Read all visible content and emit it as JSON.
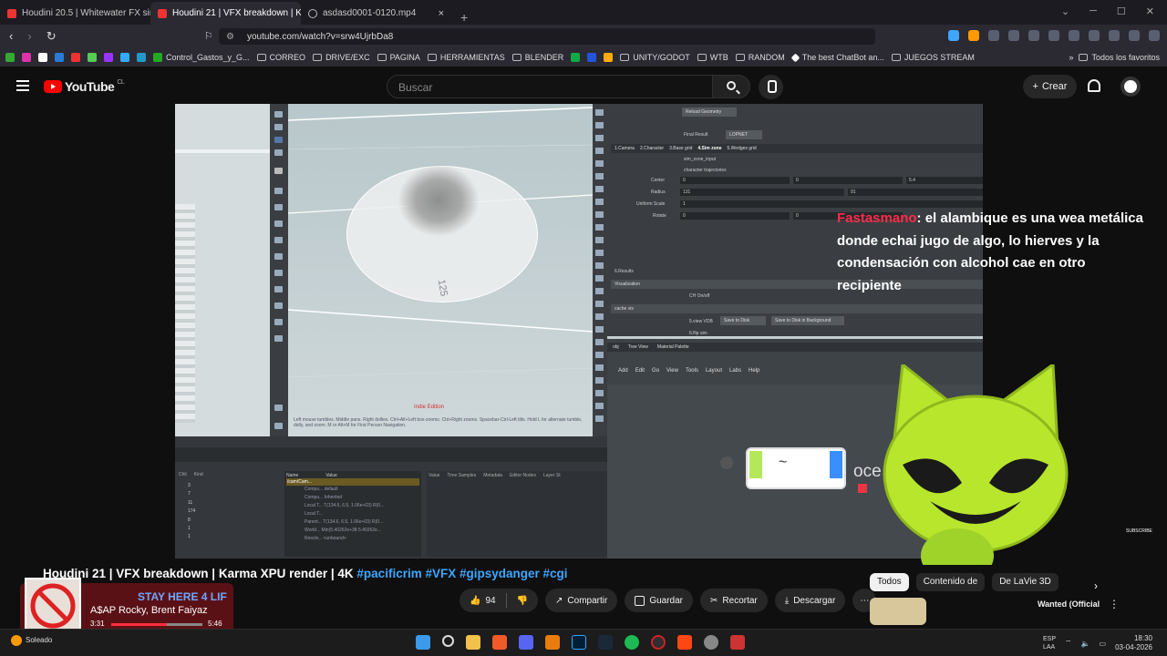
{
  "browser": {
    "tabs": [
      {
        "title": "Houdini 20.5 | Whitewater FX simulat",
        "active": false
      },
      {
        "title": "Houdini 21 | VFX breakdown | K",
        "active": true
      },
      {
        "title": "asdasd0001-0120.mp4",
        "active": false
      }
    ],
    "url": "youtube.com/watch?v=srw4UjrbDa8",
    "bookmarks": [
      "Control_Gastos_y_G...",
      "CORREO",
      "DRIVE/EXC",
      "PAGINA",
      "HERRAMIENTAS",
      "BLENDER",
      "UNITY/GODOT",
      "WTB",
      "RANDOM",
      "The best ChatBot an...",
      "JUEGOS STREAM"
    ],
    "bookmarks_right": "Todos los favoritos"
  },
  "youtube": {
    "logo": "YouTube",
    "region": "CL",
    "search_placeholder": "Buscar",
    "create_label": "Crear"
  },
  "video": {
    "chat_user": "Fastasmano",
    "chat_message": "el alambique es una wea metálica donde echai jugo de algo, lo hierves y la condensación con alcohol cae en otro recipiente",
    "overlay_text": "oce",
    "subscribe_label": "SUBSCRIBE",
    "houdini": {
      "reload_btn": "Reload Geometry",
      "final_result": "Final Result",
      "lopnet": "LOPNET",
      "tabs": [
        "1.Camera",
        "2.Character",
        "3.Base grid",
        "4.Sim zone",
        "5.Wedges grid"
      ],
      "sim_zone_input": "sim_zone_input",
      "character_traj": "character trajectories",
      "center_label": "Center",
      "center_vals": [
        "0",
        "0",
        "5.4"
      ],
      "radius_label": "Radius",
      "radius_vals": [
        "131",
        "91"
      ],
      "uniform_scale_label": "Uniform Scale",
      "uniform_scale": "1",
      "rotate_label": "Rotate",
      "rotate_vals": [
        "0",
        "0"
      ],
      "results_tab": "6.Results",
      "visualization": "Visualization",
      "ch_onoff": "CH On/off",
      "cache_vis": "cache vis",
      "view_vdb": "5.view VDB",
      "flip_sim": "6.flip sim",
      "save_disk": "Save to Disk",
      "save_bg": "Save to Disk in Background",
      "net_tabs": [
        "obj",
        "Tree View",
        "Material Palette"
      ],
      "net_menu": [
        "Add",
        "Edit",
        "Go",
        "View",
        "Tools",
        "Layout",
        "Labs",
        "Help"
      ],
      "indie": "Indie Edition",
      "viewport_help": "Left mouse tumbles. Middle pans. Right dollies. Ctrl+Alt+Left box-zooms. Ctrl+Right zooms. Spacebar-Ctrl-Left tilts. Hold L for alternate tumble, dolly, and zoom. M or Alt+M for First Person Navigation.",
      "viewport_number": "125",
      "tree_col_name": "Name",
      "tree_col_value": "Value",
      "tree_root": "/cam/Cam...",
      "tree_rows": [
        {
          "n": "Compu...",
          "v": "default"
        },
        {
          "n": "Compu...",
          "v": "Inherited"
        },
        {
          "n": "Local T...",
          "v": "T(134.6, 6.5, 1.06e+03) R(0..."
        },
        {
          "n": "Local T...",
          "v": ""
        },
        {
          "n": "Parent...",
          "v": "T(134.6, 6.5, 1.06e+03) R(0..."
        },
        {
          "n": "World...",
          "v": "Min(5.40262e+38 5.40262e..."
        },
        {
          "n": "Resolv...",
          "v": "<unbound>"
        }
      ],
      "sel_col_headers": [
        "Chil",
        "Kind"
      ],
      "sel_rows": [
        "3",
        "7",
        "11",
        "174",
        "8",
        "1",
        "1"
      ],
      "right_cols": [
        "Value",
        "Time Samples",
        "Metadata",
        "Editor Nodes",
        "Layer St"
      ]
    }
  },
  "watch": {
    "title_plain": "Houdini 21 | VFX breakdown | Karma XPU render | 4K ",
    "hashtags": "#pacificrim #VFX #gipsydanger #cgi",
    "likes": "94",
    "share": "Compartir",
    "save": "Guardar",
    "clip": "Recortar",
    "download": "Descargar",
    "chips": [
      "Todos",
      "Contenido de",
      "De LaVie 3D"
    ],
    "related_title": "Wanted (Official"
  },
  "music_widget": {
    "headline": "STAY HERE 4 LIF",
    "artist": "A$AP Rocky, Brent Faiyaz",
    "elapsed": "3:31",
    "duration": "5:46",
    "progress": 0.61
  },
  "taskbar": {
    "weather": "Soleado",
    "lang1": "ESP",
    "lang2": "LAA",
    "time": "18:30",
    "date": "03-04-2026"
  }
}
